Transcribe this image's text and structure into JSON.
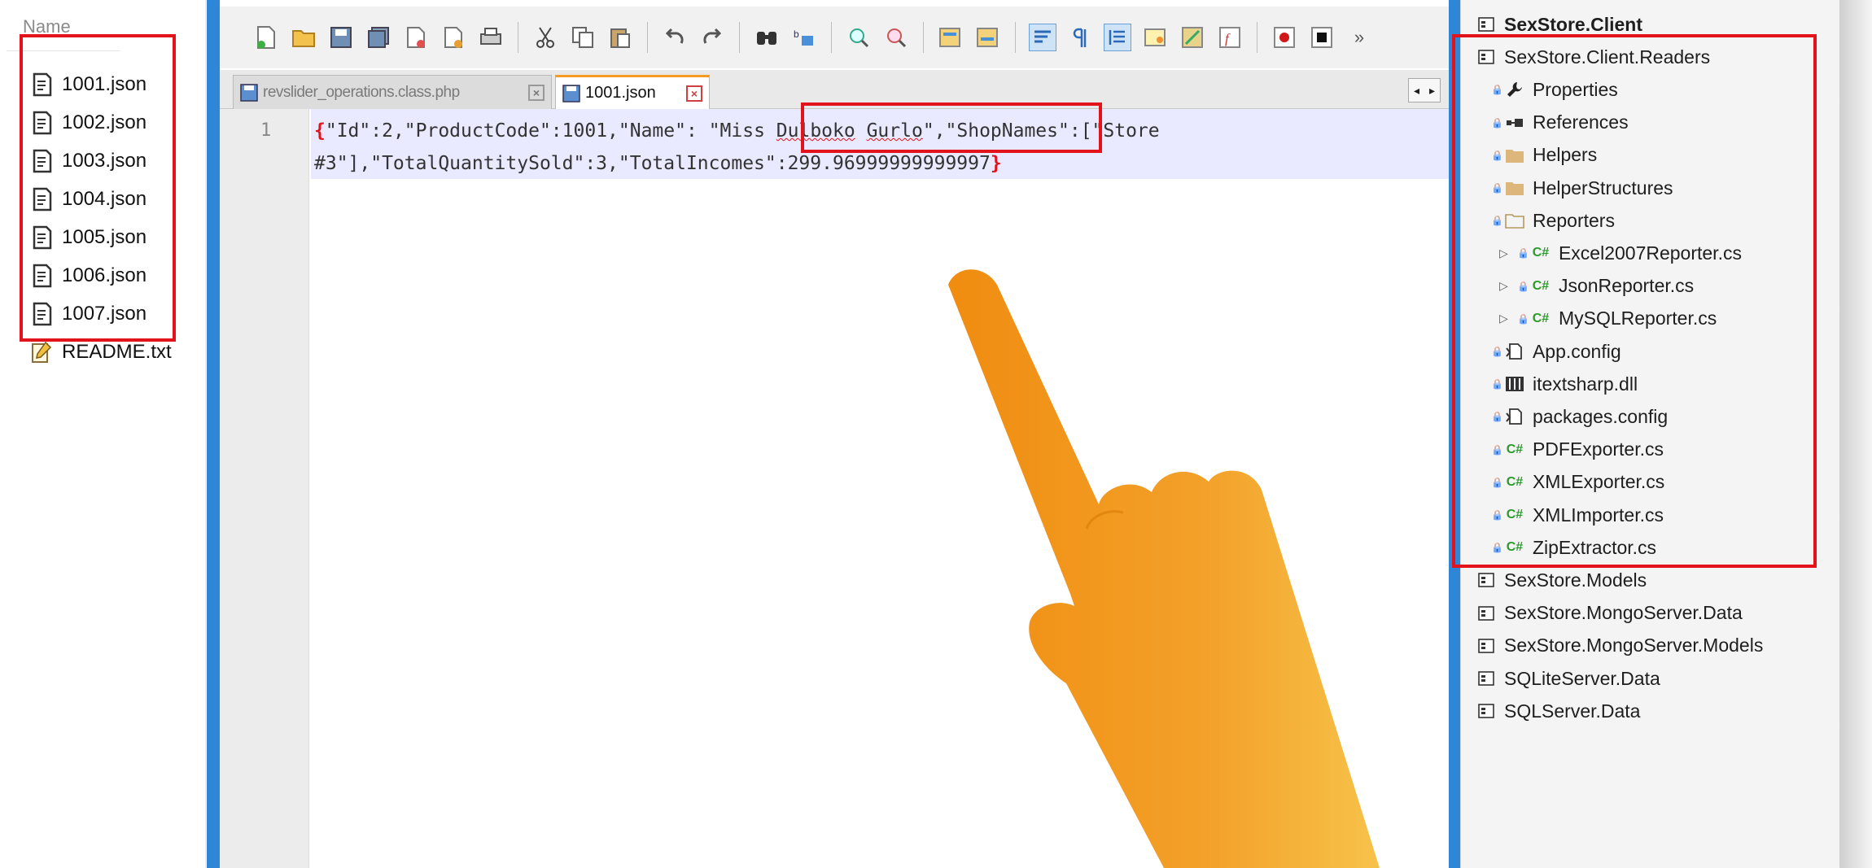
{
  "left_pane": {
    "header": "Name",
    "files": [
      "1001.json",
      "1002.json",
      "1003.json",
      "1004.json",
      "1005.json",
      "1006.json",
      "1007.json",
      "README.txt"
    ]
  },
  "editor": {
    "tabs": [
      {
        "label": "revslider_operations.class.php",
        "active": false
      },
      {
        "label": "1001.json",
        "active": true
      }
    ],
    "line_number": "1",
    "code": {
      "line1_pre": "\"Id\":2,\"ProductCode\":1001,\"Name\":",
      "line1_name_a": "\"Miss ",
      "line1_name_b": "Dulboko",
      "line1_name_c": " ",
      "line1_name_d": "Gurlo",
      "line1_name_e": "\"",
      "line1_post": ",\"ShopNames\":[\"Store",
      "line2": "#3\"],\"TotalQuantitySold\":3,\"TotalIncomes\":299.96999999999997",
      "open_brace": "{",
      "close_brace": "}"
    }
  },
  "solution_explorer": {
    "items": [
      {
        "label": "SexStore.Client",
        "indent": 0,
        "icon": "project-icon",
        "bold": true
      },
      {
        "label": "SexStore.Client.Readers",
        "indent": 0,
        "icon": "project-icon"
      },
      {
        "label": "Properties",
        "indent": 1,
        "icon": "wrench-icon"
      },
      {
        "label": "References",
        "indent": 1,
        "icon": "references-icon"
      },
      {
        "label": "Helpers",
        "indent": 1,
        "icon": "folder-icon"
      },
      {
        "label": "HelperStructures",
        "indent": 1,
        "icon": "folder-icon"
      },
      {
        "label": "Reporters",
        "indent": 1,
        "icon": "folder-open-icon"
      },
      {
        "label": "Excel2007Reporter.cs",
        "indent": 2,
        "icon": "csharp-icon",
        "expander": true
      },
      {
        "label": "JsonReporter.cs",
        "indent": 2,
        "icon": "csharp-icon",
        "expander": true
      },
      {
        "label": "MySQLReporter.cs",
        "indent": 2,
        "icon": "csharp-icon",
        "expander": true
      },
      {
        "label": "App.config",
        "indent": 1,
        "icon": "config-icon"
      },
      {
        "label": "itextsharp.dll",
        "indent": 1,
        "icon": "dll-icon"
      },
      {
        "label": "packages.config",
        "indent": 1,
        "icon": "config-icon"
      },
      {
        "label": "PDFExporter.cs",
        "indent": 1,
        "icon": "csharp-icon"
      },
      {
        "label": "XMLExporter.cs",
        "indent": 1,
        "icon": "csharp-icon"
      },
      {
        "label": "XMLImporter.cs",
        "indent": 1,
        "icon": "csharp-icon"
      },
      {
        "label": "ZipExtractor.cs",
        "indent": 1,
        "icon": "csharp-icon"
      },
      {
        "label": "SexStore.Models",
        "indent": 0,
        "icon": "project-icon"
      },
      {
        "label": "SexStore.MongoServer.Data",
        "indent": 0,
        "icon": "project-icon"
      },
      {
        "label": "SexStore.MongoServer.Models",
        "indent": 0,
        "icon": "project-icon"
      },
      {
        "label": "SQLiteServer.Data",
        "indent": 0,
        "icon": "project-icon"
      },
      {
        "label": "SQLServer.Data",
        "indent": 0,
        "icon": "project-icon"
      }
    ]
  },
  "colors": {
    "highlight_red": "#e3131b",
    "editor_blue": "#2f86d6",
    "pointer_orange": "#f39a1c",
    "current_line": "#e9e9ff"
  },
  "overlay": {
    "pointer": "hand-pointer-icon"
  }
}
